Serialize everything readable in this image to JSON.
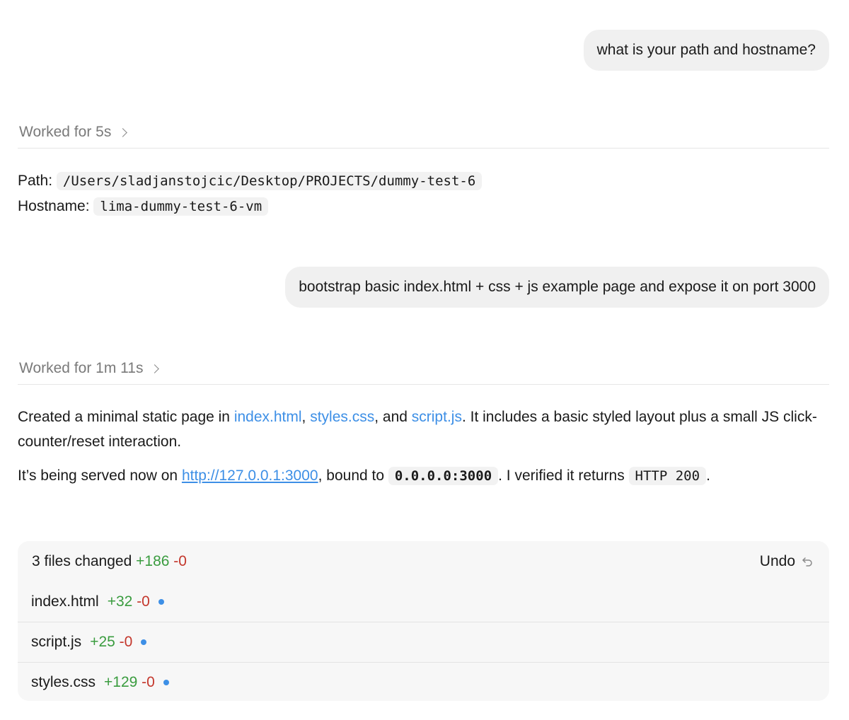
{
  "conversation": {
    "msg1": {
      "text": "what is your path and hostname?"
    },
    "worked1": {
      "label": "Worked for 5s"
    },
    "reply1": {
      "path_label": "Path:",
      "path_value": "/Users/sladjanstojcic/Desktop/PROJECTS/dummy-test-6",
      "hostname_label": "Hostname:",
      "hostname_value": "lima-dummy-test-6-vm"
    },
    "msg2": {
      "text": "bootstrap basic index.html + css + js example page and expose it on port 3000"
    },
    "worked2": {
      "label": "Worked for 1m 11s"
    },
    "reply2": {
      "p1_prefix": "Created a minimal static page in ",
      "link_index": "index.html",
      "sep1": ", ",
      "link_styles": "styles.css",
      "sep2": ", and ",
      "link_script": "script.js",
      "p1_suffix": ". It includes a basic styled layout plus a small JS click-counter/reset interaction.",
      "p2_prefix": "It’s being served now on ",
      "url": "http://127.0.0.1:3000",
      "p2_mid": ", bound to ",
      "bind_code": "0.0.0.0:3000",
      "p2_mid2": ". I verified it returns ",
      "status_code": "HTTP 200",
      "p2_suffix": "."
    }
  },
  "changes": {
    "summary": "3 files changed",
    "added": "+186",
    "removed": "-0",
    "undo_label": "Undo",
    "files": [
      {
        "name": "index.html",
        "added": "+32",
        "removed": "-0"
      },
      {
        "name": "script.js",
        "added": "+25",
        "removed": "-0"
      },
      {
        "name": "styles.css",
        "added": "+129",
        "removed": "-0"
      }
    ]
  },
  "colors": {
    "link": "#3d8fe6",
    "added": "#3a9c3f",
    "removed": "#c4372c",
    "bubble": "#f0f0f0",
    "panel": "#f7f7f7"
  }
}
